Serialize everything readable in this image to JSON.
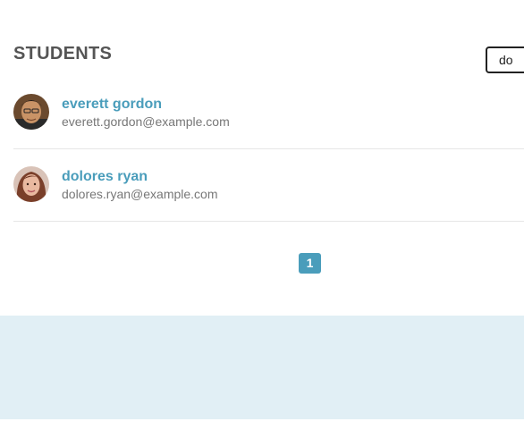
{
  "header": {
    "title": "STUDENTS"
  },
  "search": {
    "value": "do",
    "icon": "text-cursor"
  },
  "students": [
    {
      "name": "everett gordon",
      "email": "everett.gordon@example.com",
      "avatar": "male-portrait"
    },
    {
      "name": "dolores ryan",
      "email": "dolores.ryan@example.com",
      "avatar": "female-portrait"
    }
  ],
  "pagination": {
    "current_page": "1"
  },
  "colors": {
    "accent": "#4a9dbb",
    "heading": "#555555",
    "muted_text": "#777777",
    "footer_band": "#e1eff5",
    "divider": "#e6e6e6"
  }
}
